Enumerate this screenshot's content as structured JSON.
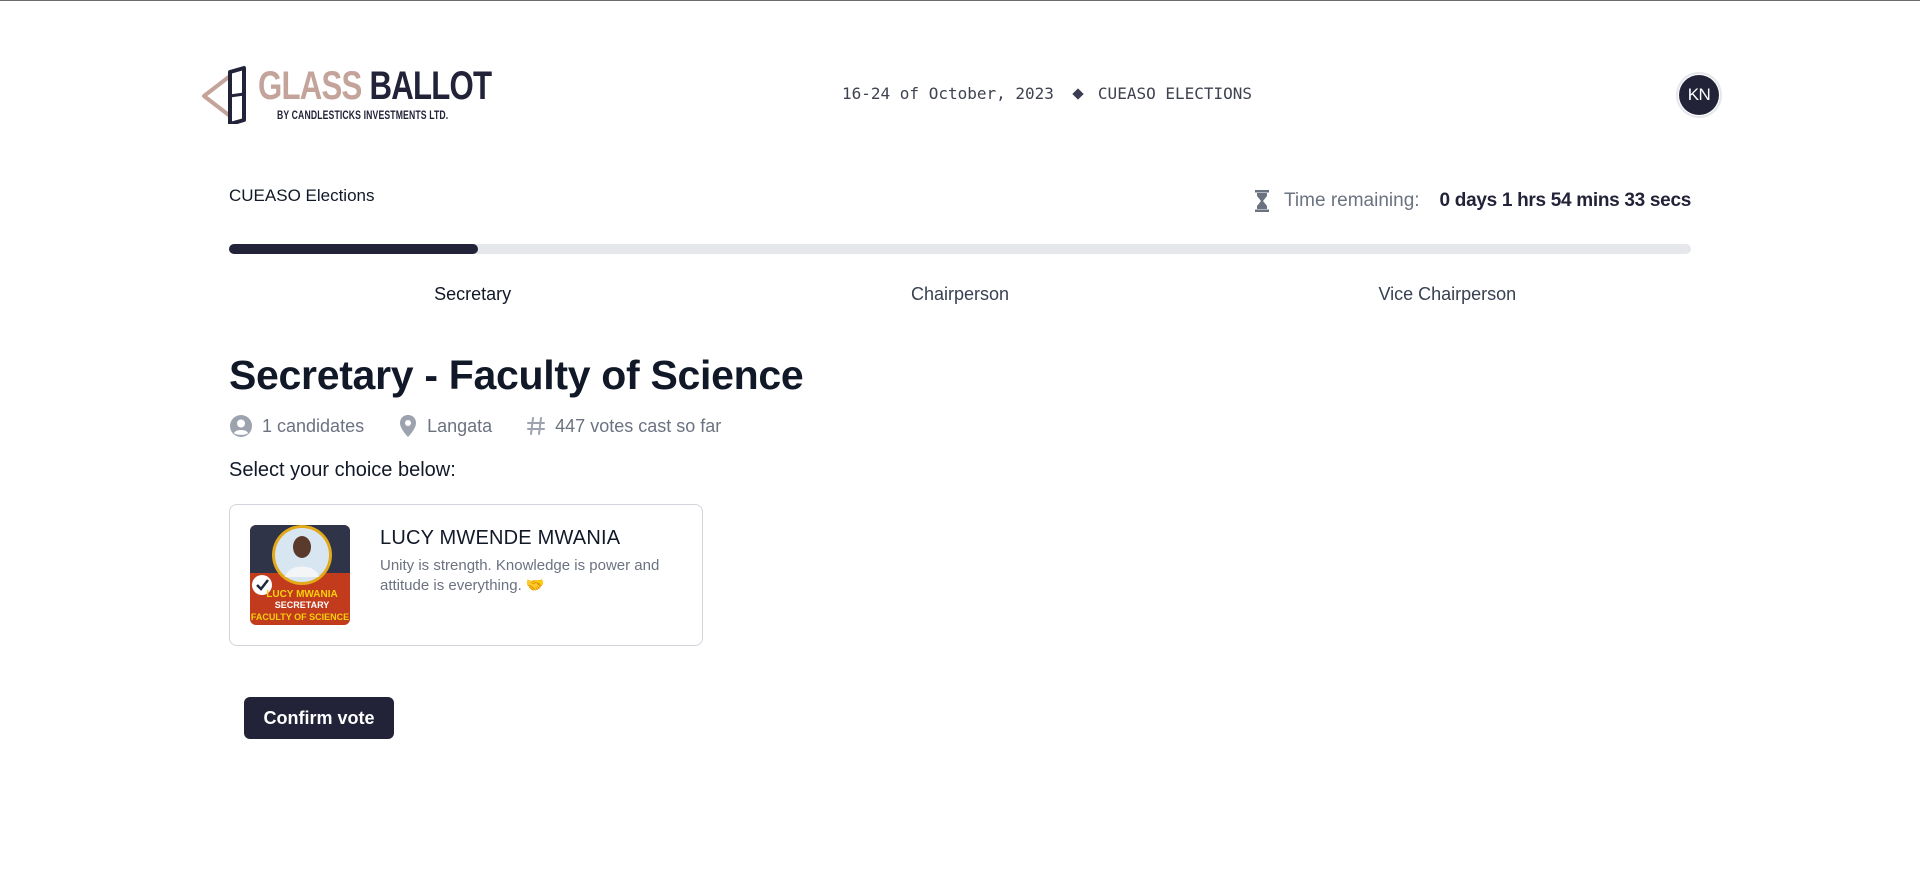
{
  "brand": {
    "name_part1": "GLASS",
    "name_part2": "BALLOT",
    "subtitle": "BY CANDLESTICKS INVESTMENTS LTD.",
    "colors": {
      "primary": "#222338",
      "accent": "#c4a39b"
    }
  },
  "header": {
    "date_range": "16-24 of October, 2023",
    "election_tag": "CUEASO ELECTIONS",
    "user_initials": "KN"
  },
  "election": {
    "name": "CUEASO Elections",
    "time_remaining_label": "Time remaining:",
    "time_remaining_value": "0 days 1 hrs 54 mins 33 secs",
    "progress_fraction": 0.17
  },
  "steps": [
    {
      "label": "Secretary",
      "active": true
    },
    {
      "label": "Chairperson",
      "active": false
    },
    {
      "label": "Vice Chairperson",
      "active": false
    }
  ],
  "position": {
    "title": "Secretary - Faculty of Science",
    "candidates_count": "1 candidates",
    "location": "Langata",
    "votes_cast": "447 votes cast so far",
    "choose_prompt": "Select your choice below:"
  },
  "candidates": [
    {
      "name": "LUCY MWENDE MWANIA",
      "motto": "Unity is strength. Knowledge is power and attitude is everything. 🤝",
      "poster_lines": [
        "LUCY MWANIA",
        "SECRETARY",
        "FACULTY OF SCIENCE"
      ]
    }
  ],
  "actions": {
    "confirm_label": "Confirm vote"
  },
  "icons": {
    "timer": "hourglass-icon",
    "candidates": "user-circle-icon",
    "location": "map-pin-icon",
    "votes": "hash-icon"
  }
}
